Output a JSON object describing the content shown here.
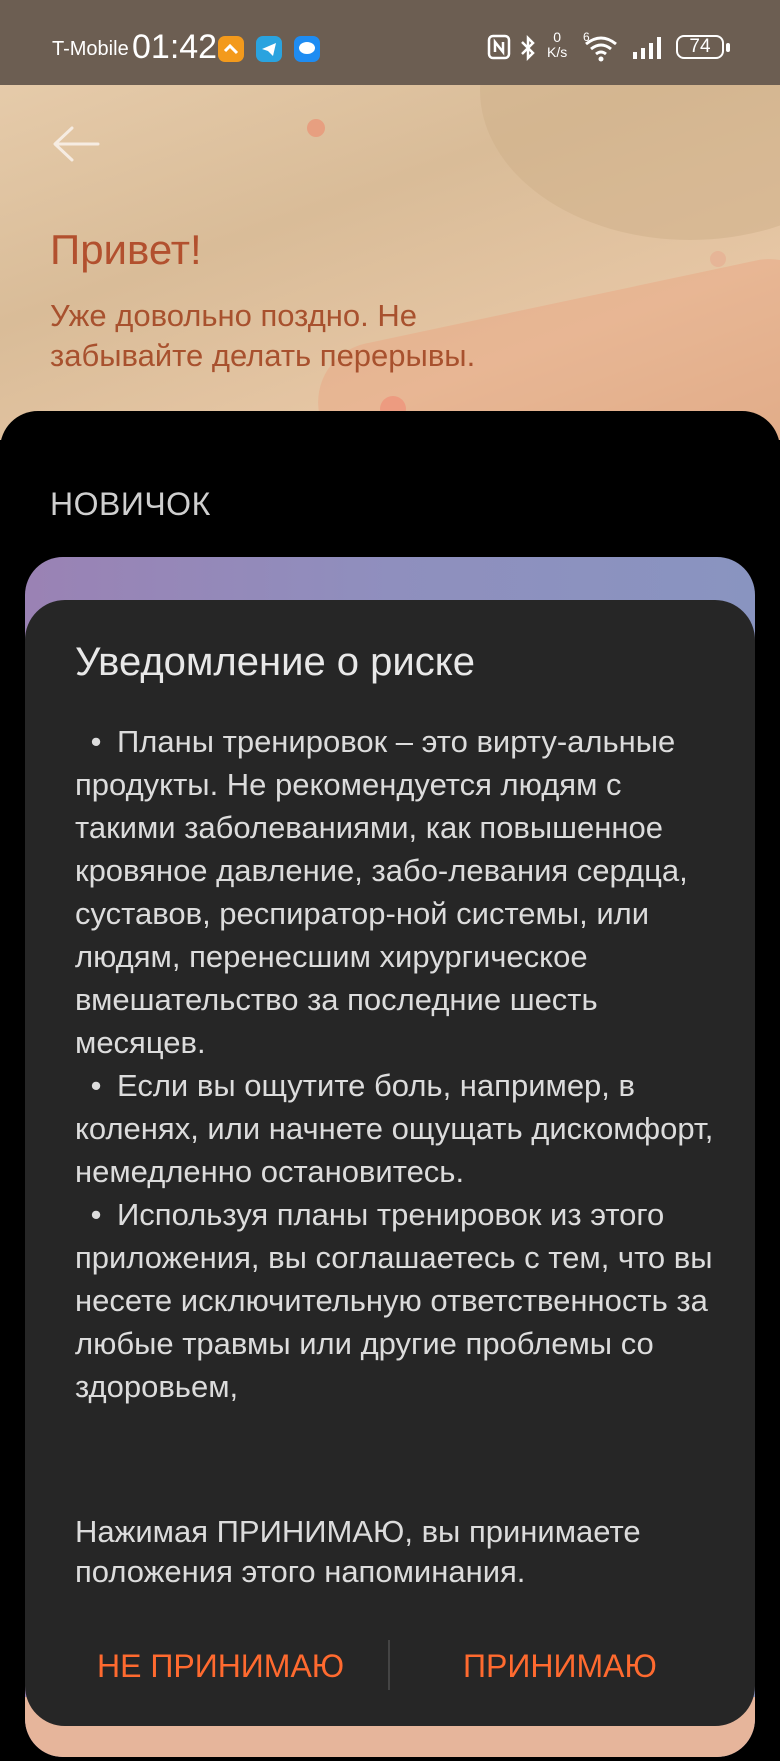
{
  "status_bar": {
    "carrier": "T-Mobile",
    "time": "01:42",
    "net_speed_value": "0",
    "net_speed_unit": "K/s",
    "wifi_badge": "6",
    "battery": "74"
  },
  "header": {
    "title": "Привет!",
    "subtitle": "Уже довольно поздно. Не забывайте делать перерывы."
  },
  "section": {
    "label": "НОВИЧОК"
  },
  "dialog": {
    "title": "Уведомление о риске",
    "bullets": [
      "Планы тренировок – это вирту-альные продукты. Не рекомендуется людям с такими заболеваниями, как повышенное кровяное давление, забо-левания сердца, суставов, респиратор-ной системы, или людям, перенесшим хирургическое вмешательство за последние шесть месяцев.",
      "Если вы ощутите боль, например, в коленях, или начнете ощущать дискомфорт, немедленно остановитесь.",
      "Используя планы тренировок из этого приложения, вы соглашаетесь с тем, что вы несете исключительную ответственность за любые травмы или другие проблемы со здоровьем,"
    ],
    "note": "Нажимая ПРИНИМАЮ, вы принимаете положения этого напоминания.",
    "decline_label": "НЕ ПРИНИМАЮ",
    "accept_label": "ПРИНИМАЮ"
  },
  "colors": {
    "accent": "#ff6a2f",
    "header_text": "#b2502e",
    "dialog_bg": "#262626"
  },
  "icons": [
    "back-arrow-icon",
    "wifi-icon",
    "signal-icon",
    "bluetooth-icon",
    "nfc-icon",
    "battery-icon"
  ]
}
